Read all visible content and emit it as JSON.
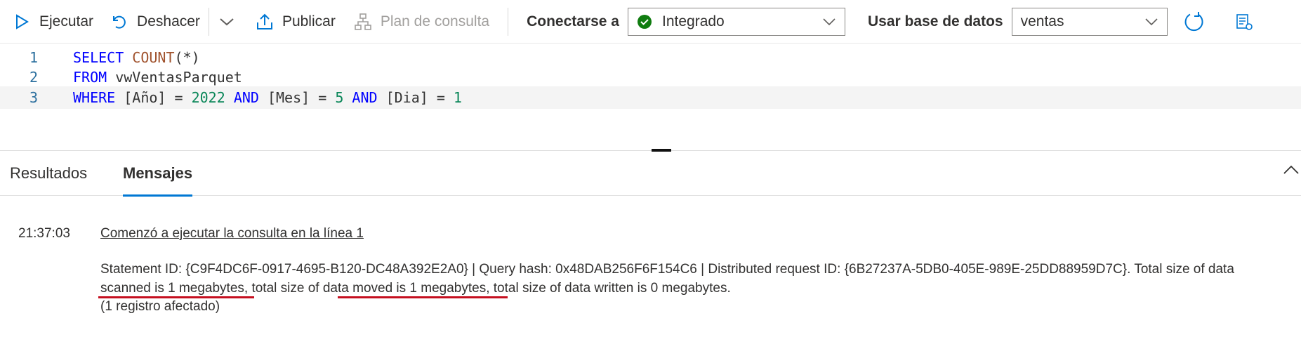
{
  "toolbar": {
    "run_label": "Ejecutar",
    "undo_label": "Deshacer",
    "publish_label": "Publicar",
    "query_plan_label": "Plan de consulta",
    "connect_label": "Conectarse a",
    "connection_value": "Integrado",
    "database_label": "Usar base de datos",
    "database_value": "ventas"
  },
  "editor": {
    "lines": [
      {
        "number": "1",
        "tokens": [
          "SELECT",
          " ",
          "COUNT",
          "(*)"
        ]
      },
      {
        "number": "2",
        "tokens": [
          "FROM",
          " vwVentasParquet"
        ]
      },
      {
        "number": "3",
        "tokens": [
          "WHERE",
          " [Año] = ",
          "2022",
          " ",
          "AND",
          " [Mes] = ",
          "5",
          " ",
          "AND",
          " [Dia] = ",
          "1"
        ]
      }
    ]
  },
  "tabs": [
    {
      "label": "Resultados",
      "active": false
    },
    {
      "label": "Mensajes",
      "active": true
    }
  ],
  "messages": {
    "time": "21:37:03",
    "started": "Comenzó a ejecutar la consulta en la línea 1",
    "statement_line1": "Statement ID: {C9F4DC6F-0917-4695-B120-DC48A392E2A0} | Query hash: 0x48DAB256F6F154C6 | Distributed request ID: {6B27237A-5DB0-405E-989E-25DD88959D7C}. Total size of data",
    "statement_line2_a": "scanned is 1 megabytes",
    "statement_line2_b": ", total size of ",
    "statement_line2_c": "data moved is 1 megabytes",
    "statement_line2_d": ", total size of data written is 0 megabytes.",
    "affected": "(1 registro afectado)"
  },
  "colors": {
    "accent": "#0078d4",
    "success": "#107c10",
    "highlight_underline": "#c50f1f",
    "keyword": "#0000ff",
    "function": "#a0522d",
    "number": "#098658"
  }
}
